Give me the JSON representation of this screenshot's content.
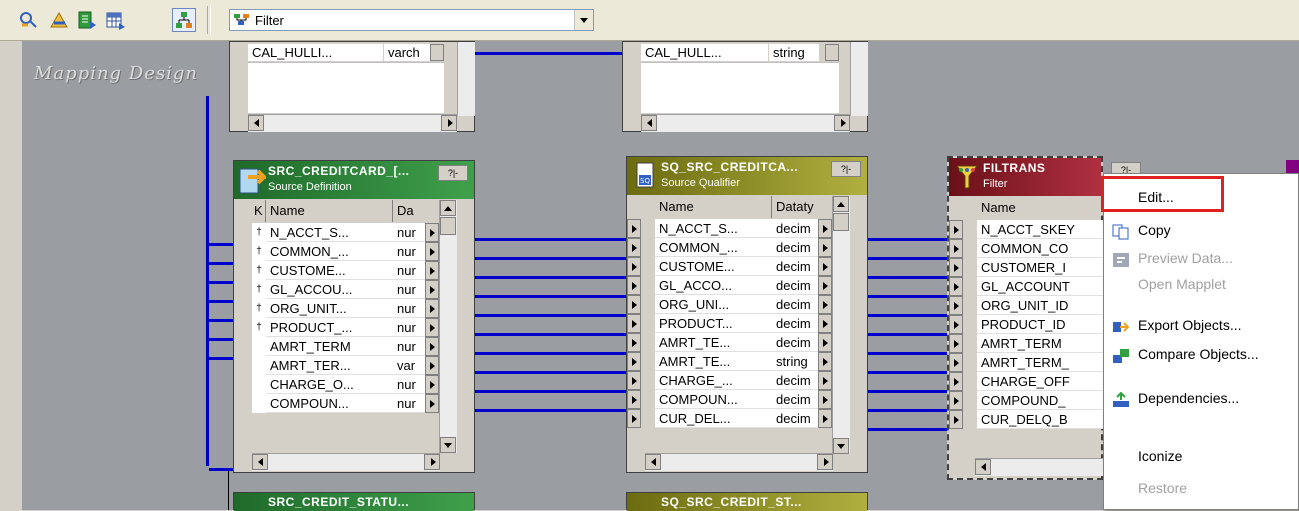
{
  "toolbar": {
    "icons": [
      "flow-arrow-icon",
      "triangle-arrow-icon",
      "green-doc-icon",
      "grid-icon",
      "tree-icon"
    ],
    "filter_combo": {
      "value": "Filter",
      "icon": "filter-transform-icon"
    }
  },
  "canvas": {
    "title": "Mapping Design"
  },
  "top_panels": [
    {
      "row_text": "CAL_HULLI...",
      "type_text": "varch"
    },
    {
      "row_text": "CAL_HULL...",
      "type_text": "string"
    }
  ],
  "source_def": {
    "title": "SRC_CREDITCARD_[...",
    "subtitle": "Source Definition",
    "col_key": "K",
    "col_name": "Name",
    "col_type": "Da",
    "rows": [
      {
        "key": true,
        "name": "N_ACCT_S...",
        "type": "nur"
      },
      {
        "key": true,
        "name": "COMMON_...",
        "type": "nur"
      },
      {
        "key": true,
        "name": "CUSTOME...",
        "type": "nur"
      },
      {
        "key": true,
        "name": "GL_ACCOU...",
        "type": "nur"
      },
      {
        "key": true,
        "name": "ORG_UNIT...",
        "type": "nur"
      },
      {
        "key": true,
        "name": "PRODUCT_...",
        "type": "nur"
      },
      {
        "key": false,
        "name": "AMRT_TERM",
        "type": "nur"
      },
      {
        "key": false,
        "name": "AMRT_TER...",
        "type": "var"
      },
      {
        "key": false,
        "name": "CHARGE_O...",
        "type": "nur"
      },
      {
        "key": false,
        "name": "COMPOUN...",
        "type": "nur"
      }
    ]
  },
  "source_qualifier": {
    "title": "SQ_SRC_CREDITCA...",
    "subtitle": "Source Qualifier",
    "col_name": "Name",
    "col_type": "Dataty",
    "rows": [
      {
        "name": "N_ACCT_S...",
        "type": "decim"
      },
      {
        "name": "COMMON_...",
        "type": "decim"
      },
      {
        "name": "CUSTOME...",
        "type": "decim"
      },
      {
        "name": "GL_ACCO...",
        "type": "decim"
      },
      {
        "name": "ORG_UNI...",
        "type": "decim"
      },
      {
        "name": "PRODUCT...",
        "type": "decim"
      },
      {
        "name": "AMRT_TE...",
        "type": "decim"
      },
      {
        "name": "AMRT_TE...",
        "type": "string"
      },
      {
        "name": "CHARGE_...",
        "type": "decim"
      },
      {
        "name": "COMPOUN...",
        "type": "decim"
      },
      {
        "name": "CUR_DEL...",
        "type": "decim"
      }
    ]
  },
  "filter": {
    "title": "FILTRANS",
    "subtitle": "Filter",
    "col_name": "Name",
    "rows": [
      "N_ACCT_SKEY",
      "COMMON_CO",
      "CUSTOMER_I",
      "GL_ACCOUNT",
      "ORG_UNIT_ID",
      "PRODUCT_ID",
      "AMRT_TERM",
      "AMRT_TERM_",
      "CHARGE_OFF",
      "COMPOUND_",
      "CUR_DELQ_B"
    ]
  },
  "bottom_panels": [
    {
      "title": "SRC_CREDIT_STATU..."
    },
    {
      "title": "SQ_SRC_CREDIT_ST..."
    }
  ],
  "context_menu": {
    "items": [
      {
        "label": "Edit...",
        "icon": "",
        "enabled": true
      },
      {
        "label": "Copy",
        "icon": "copy-icon",
        "enabled": true
      },
      {
        "label": "Preview Data...",
        "icon": "preview-icon",
        "enabled": false
      },
      {
        "label": "Open Mapplet",
        "icon": "",
        "enabled": false
      },
      {
        "label": "Export Objects...",
        "icon": "export-icon",
        "enabled": true
      },
      {
        "label": "Compare Objects...",
        "icon": "compare-icon",
        "enabled": true
      },
      {
        "label": "Dependencies...",
        "icon": "dependencies-icon",
        "enabled": true
      },
      {
        "label": "Iconize",
        "icon": "",
        "enabled": true
      },
      {
        "label": "Restore",
        "icon": "",
        "enabled": false
      }
    ]
  },
  "colors": {
    "source_header": "#2f8a3b",
    "qualifier_header": "#8a8a1e",
    "filter_header": "#8a1e24",
    "link": "#0000cc",
    "highlight": "#e0221f"
  }
}
